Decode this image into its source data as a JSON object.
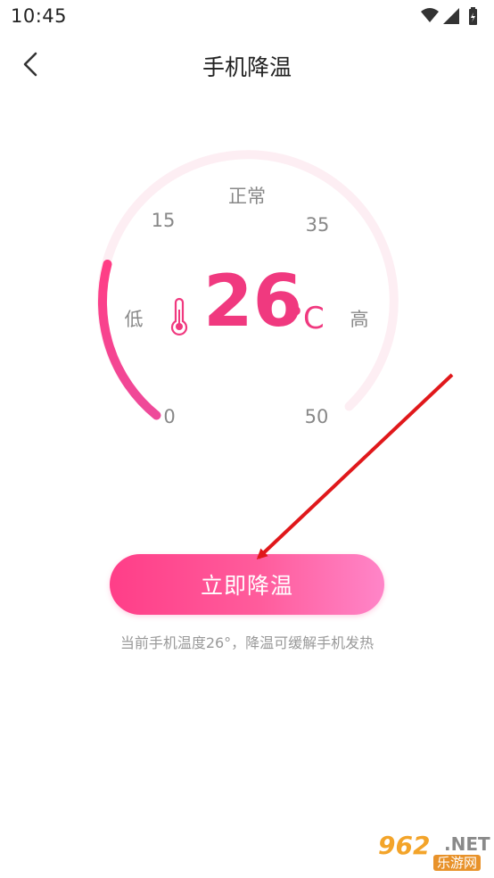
{
  "status_bar": {
    "time": "10:45",
    "icons": [
      "wifi-icon",
      "signal-icon",
      "battery-charging-icon"
    ]
  },
  "header": {
    "back_icon": "chevron-left-icon",
    "title": "手机降温"
  },
  "gauge": {
    "top_label": "正常",
    "left_label": "低",
    "right_label": "高",
    "tick_labels": {
      "t0": "0",
      "t15": "15",
      "t35": "35",
      "t50": "50"
    },
    "range": [
      0,
      50
    ],
    "value": 26,
    "temperature": "26",
    "unit": "°C",
    "thermometer_icon": "thermometer-icon",
    "colors": {
      "accent": "#f0397f",
      "track": "#fdeef3"
    }
  },
  "cool_button": {
    "label": "立即降温"
  },
  "hint": "当前手机温度26°，降温可缓解手机发热",
  "watermark": {
    "brand": "962",
    "suffix": ".NET",
    "subtitle": "乐游网"
  }
}
